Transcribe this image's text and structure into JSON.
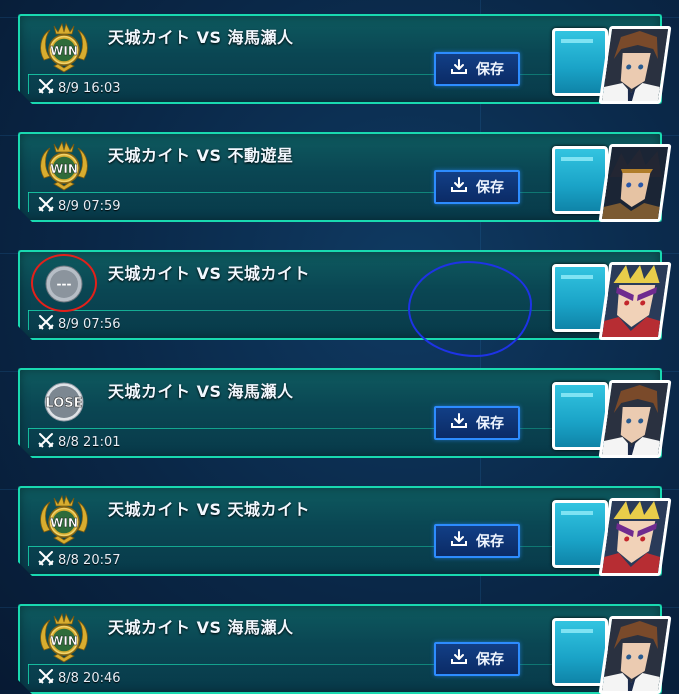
{
  "colors": {
    "panel_border": "#19d9b0",
    "save_button_border": "#2d8cff",
    "win_gold": "#e2b93a",
    "annotation_red": "#e4201a",
    "annotation_blue": "#1e33e6"
  },
  "entries": [
    {
      "result": "WIN",
      "title": "天城カイト VS 海馬瀬人",
      "timestamp": "8/9 16:03",
      "save_label": "保存",
      "opponent_icon": "portrait-seto-kaiba-icon"
    },
    {
      "result": "WIN",
      "title": "天城カイト VS 不動遊星",
      "timestamp": "8/9 07:59",
      "save_label": "保存",
      "opponent_icon": "portrait-yusei-fudo-icon"
    },
    {
      "result": "---",
      "title": "天城カイト VS 天城カイト",
      "timestamp": "8/9 07:56",
      "save_label": null,
      "opponent_icon": "portrait-kaito-tenjo-icon"
    },
    {
      "result": "LOSE",
      "title": "天城カイト VS 海馬瀬人",
      "timestamp": "8/8 21:01",
      "save_label": "保存",
      "opponent_icon": "portrait-seto-kaiba-icon"
    },
    {
      "result": "WIN",
      "title": "天城カイト VS 天城カイト",
      "timestamp": "8/8 20:57",
      "save_label": "保存",
      "opponent_icon": "portrait-kaito-tenjo-icon"
    },
    {
      "result": "WIN",
      "title": "天城カイト VS 海馬瀬人",
      "timestamp": "8/8 20:46",
      "save_label": "保存",
      "opponent_icon": "portrait-seto-kaiba-icon"
    }
  ]
}
